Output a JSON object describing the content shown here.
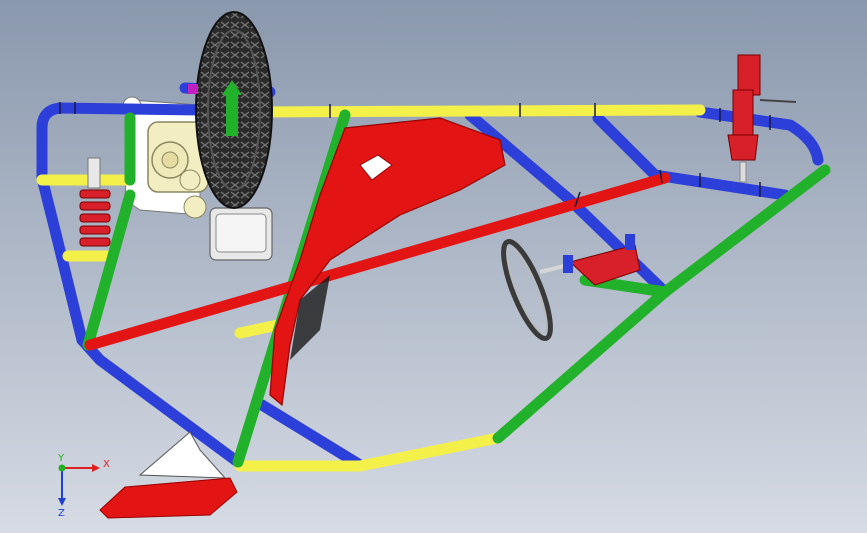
{
  "viewport": {
    "background_top": "#8a98ad",
    "background_bottom": "#d6dbe4"
  },
  "colors": {
    "blue": "#2c3fd8",
    "yellow": "#f4f04a",
    "green": "#22b12a",
    "red": "#e21414",
    "shock_red": "#d8202a",
    "tire": "#2a2a2a",
    "engine": "#f3eec2",
    "plate": "#ffffff"
  },
  "axis_triad": {
    "x_label": "X",
    "y_label": "Y",
    "z_label": "Z",
    "x_color": "#e02020",
    "y_color": "#20b020",
    "z_color": "#2040d0"
  }
}
